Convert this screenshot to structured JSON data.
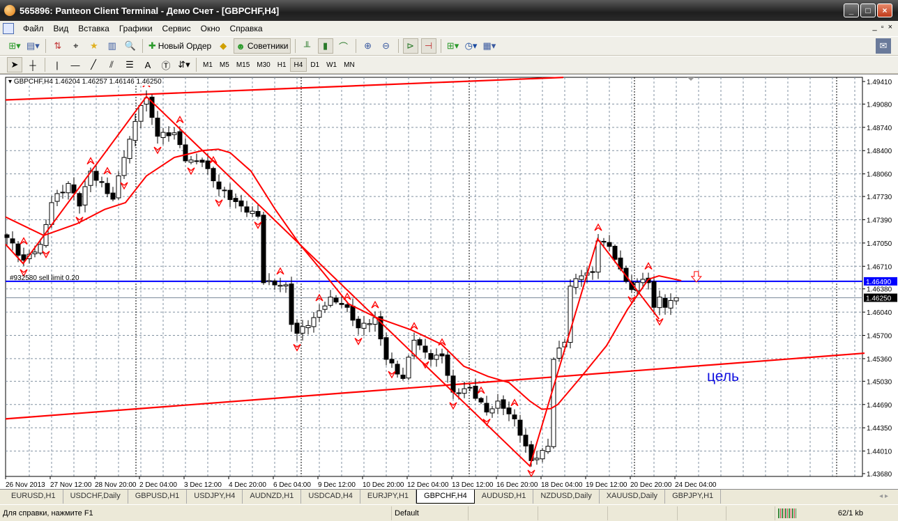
{
  "window": {
    "title": "565896: Panteon Client Terminal - Демо Счет - [GBPCHF,H4]",
    "buttons": [
      "_",
      "□",
      "×"
    ]
  },
  "menu": {
    "items": [
      "Файл",
      "Вид",
      "Вставка",
      "Графики",
      "Сервис",
      "Окно",
      "Справка"
    ],
    "mdi": [
      "_",
      "▫",
      "×"
    ]
  },
  "toolbar": {
    "new_order": "Новый Ордер",
    "experts": "Советники"
  },
  "timeframes": [
    "M1",
    "M5",
    "M15",
    "M30",
    "H1",
    "H4",
    "D1",
    "W1",
    "MN"
  ],
  "active_timeframe": "H4",
  "chart": {
    "header": "GBPCHF,H4  1.46204 1.46257 1.46146 1.46250",
    "order_label": "#932580 sell limit 0.20",
    "annotation": "цель"
  },
  "chart_data": {
    "type": "candlestick",
    "symbol": "GBPCHF",
    "timeframe": "H4",
    "ylim": [
      1.4368,
      1.4941
    ],
    "price_ticks": [
      "1.49410",
      "1.49080",
      "1.48740",
      "1.48400",
      "1.48060",
      "1.47730",
      "1.47390",
      "1.47050",
      "1.46710",
      "1.46380",
      "1.46040",
      "1.45700",
      "1.45360",
      "1.45030",
      "1.44690",
      "1.44350",
      "1.44010",
      "1.43680"
    ],
    "time_ticks": [
      "26 Nov 2013",
      "27 Nov 12:00",
      "28 Nov 20:00",
      "2 Dec 04:00",
      "3 Dec 12:00",
      "4 Dec 20:00",
      "6 Dec 04:00",
      "9 Dec 12:00",
      "10 Dec 20:00",
      "12 Dec 04:00",
      "13 Dec 12:00",
      "16 Dec 20:00",
      "18 Dec 04:00",
      "19 Dec 12:00",
      "20 Dec 20:00",
      "24 Dec 04:00"
    ],
    "bars_per_time_tick": 8,
    "last": {
      "open": 1.46204,
      "high": 1.46257,
      "low": 1.46146,
      "close": 1.4625
    },
    "close_keypoints": [
      [
        0,
        1.4713
      ],
      [
        3,
        1.468
      ],
      [
        6,
        1.4703
      ],
      [
        8,
        1.4764
      ],
      [
        11,
        1.4792
      ],
      [
        13,
        1.4759
      ],
      [
        15,
        1.481
      ],
      [
        19,
        1.4769
      ],
      [
        21,
        1.483
      ],
      [
        24,
        1.4906
      ],
      [
        25,
        1.4917
      ],
      [
        27,
        1.4861
      ],
      [
        30,
        1.4866
      ],
      [
        32,
        1.4825
      ],
      [
        35,
        1.4823
      ],
      [
        38,
        1.4784
      ],
      [
        42,
        1.4759
      ],
      [
        45,
        1.4744
      ],
      [
        46,
        1.4647
      ],
      [
        50,
        1.4644
      ],
      [
        51,
        1.4586
      ],
      [
        52,
        1.4573
      ],
      [
        55,
        1.4596
      ],
      [
        58,
        1.4626
      ],
      [
        61,
        1.4611
      ],
      [
        63,
        1.4581
      ],
      [
        66,
        1.4596
      ],
      [
        68,
        1.4535
      ],
      [
        71,
        1.4507
      ],
      [
        73,
        1.4563
      ],
      [
        76,
        1.4535
      ],
      [
        78,
        1.454
      ],
      [
        80,
        1.4487
      ],
      [
        83,
        1.4494
      ],
      [
        86,
        1.4458
      ],
      [
        88,
        1.4474
      ],
      [
        91,
        1.4448
      ],
      [
        94,
        1.4387
      ],
      [
        96,
        1.4402
      ],
      [
        97,
        1.4408
      ],
      [
        98,
        1.4535
      ],
      [
        100,
        1.456
      ],
      [
        101,
        1.4642
      ],
      [
        103,
        1.4657
      ],
      [
        105,
        1.4662
      ],
      [
        106,
        1.4708
      ],
      [
        108,
        1.47
      ],
      [
        110,
        1.4667
      ],
      [
        112,
        1.4637
      ],
      [
        114,
        1.4652
      ],
      [
        115,
        1.4647
      ],
      [
        116,
        1.4611
      ],
      [
        117,
        1.4626
      ],
      [
        118,
        1.4611
      ],
      [
        119,
        1.4621
      ],
      [
        120,
        1.4625
      ]
    ],
    "sell_limit_price": 1.4649,
    "sell_limit_label": "1.46490",
    "bid_price": 1.4625,
    "bid_label": "1.46250",
    "trendlines": [
      [
        [
          -0.25,
          1.4914
        ],
        [
          99.75,
          1.4947
        ]
      ],
      [
        [
          -0.25,
          1.4448
        ],
        [
          153.75,
          1.4544
        ]
      ]
    ],
    "zigzag": [
      [
        -0.25,
        1.4703
      ],
      [
        2.9,
        1.4675
      ],
      [
        25,
        1.4919
      ],
      [
        93.75,
        1.4379
      ],
      [
        105.9,
        1.4711
      ],
      [
        116.9,
        1.4594
      ]
    ],
    "moving_average": [
      [
        -0.25,
        1.4743
      ],
      [
        6.6,
        1.4716
      ],
      [
        12.5,
        1.4733
      ],
      [
        17.5,
        1.4754
      ],
      [
        21.25,
        1.4764
      ],
      [
        25,
        1.4803
      ],
      [
        30,
        1.483
      ],
      [
        35,
        1.484
      ],
      [
        37.9,
        1.4842
      ],
      [
        40,
        1.4837
      ],
      [
        43.75,
        1.481
      ],
      [
        48.1,
        1.4754
      ],
      [
        52.5,
        1.4703
      ],
      [
        56.9,
        1.466
      ],
      [
        61.25,
        1.4616
      ],
      [
        66.25,
        1.4596
      ],
      [
        72.5,
        1.4578
      ],
      [
        77.9,
        1.4557
      ],
      [
        81.9,
        1.4525
      ],
      [
        86.25,
        1.451
      ],
      [
        90,
        1.4501
      ],
      [
        93.75,
        1.4474
      ],
      [
        95.9,
        1.4462
      ],
      [
        97.5,
        1.4463
      ],
      [
        98.75,
        1.4469
      ],
      [
        102.9,
        1.4509
      ],
      [
        107.5,
        1.4555
      ],
      [
        111.25,
        1.4608
      ],
      [
        115,
        1.4652
      ],
      [
        116.9,
        1.4657
      ],
      [
        120.9,
        1.465
      ]
    ],
    "fractals_up": [
      3,
      15,
      18,
      25,
      31,
      37,
      49,
      56,
      61,
      66,
      73,
      78,
      85,
      91,
      106,
      115
    ],
    "fractals_down": [
      3,
      7,
      13,
      21,
      27,
      33,
      38,
      45,
      52,
      63,
      69,
      75,
      80,
      86,
      94,
      112,
      117
    ],
    "target_arrow_bar": 123.6,
    "colors": {
      "bull": "#ffffff",
      "bear": "#000000",
      "indicator": "#ff0000",
      "order": "#0000ff",
      "grid": "#8090a0"
    }
  },
  "tabs": [
    "EURUSD,H1",
    "USDCHF,Daily",
    "GBPUSD,H1",
    "USDJPY,H4",
    "AUDNZD,H1",
    "USDCAD,H4",
    "EURJPY,H1",
    "GBPCHF,H4",
    "AUDUSD,H1",
    "NZDUSD,Daily",
    "XAUUSD,Daily",
    "GBPJPY,H1"
  ],
  "active_tab": "GBPCHF,H4",
  "status": {
    "help": "Для справки, нажмите F1",
    "profile": "Default",
    "traffic": "62/1 kb"
  }
}
